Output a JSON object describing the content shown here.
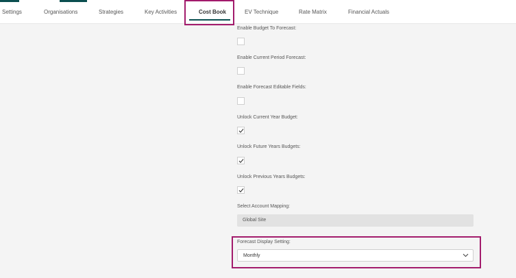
{
  "tabs": [
    {
      "label": "Settings"
    },
    {
      "label": "Organisations"
    },
    {
      "label": "Strategies"
    },
    {
      "label": "Key Activities"
    },
    {
      "label": "Cost Book",
      "active": true
    },
    {
      "label": "EV Technique"
    },
    {
      "label": "Rate Matrix"
    },
    {
      "label": "Financial Actuals"
    }
  ],
  "fields": [
    {
      "label": "Enable Budget To Forecast:",
      "checked": false
    },
    {
      "label": "Enable Current Period Forecast:",
      "checked": false
    },
    {
      "label": "Enable Forecast Editable Fields:",
      "checked": false
    },
    {
      "label": "Unlock Current Year Budget:",
      "checked": true
    },
    {
      "label": "Unlock Future Years Budgets:",
      "checked": true
    },
    {
      "label": "Unlock Previous Years Budgets:",
      "checked": true
    }
  ],
  "account_mapping": {
    "label": "Select Account Mapping:",
    "value": "Global Site"
  },
  "forecast_display": {
    "label": "Forecast Display Setting:",
    "value": "Monthly"
  },
  "colors": {
    "accent": "#0b4f50",
    "highlight": "#a21a6b"
  },
  "icons": {
    "check": "check-icon",
    "dropdown": "chevron-down-icon"
  }
}
